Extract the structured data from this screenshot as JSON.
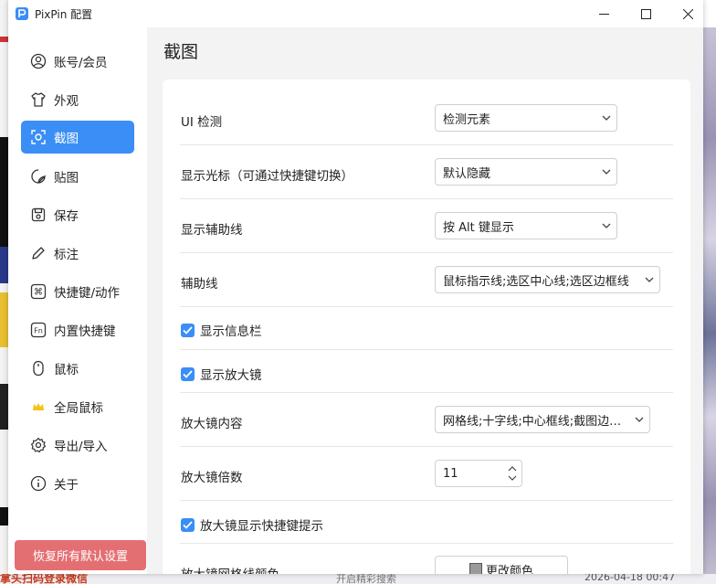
{
  "window": {
    "title": "PixPin 配置",
    "accent": "#3a8ef6"
  },
  "sidebar": {
    "items": [
      {
        "label": "账号/会员",
        "icon": "user-circle-icon"
      },
      {
        "label": "外观",
        "icon": "shirt-icon"
      },
      {
        "label": "截图",
        "icon": "screenshot-icon"
      },
      {
        "label": "贴图",
        "icon": "pin-icon"
      },
      {
        "label": "保存",
        "icon": "save-icon"
      },
      {
        "label": "标注",
        "icon": "pencil-icon"
      },
      {
        "label": "快捷键/动作",
        "icon": "command-key-icon"
      },
      {
        "label": "内置快捷键",
        "icon": "fn-key-icon"
      },
      {
        "label": "鼠标",
        "icon": "mouse-icon"
      },
      {
        "label": "全局鼠标",
        "icon": "crown-icon"
      },
      {
        "label": "导出/导入",
        "icon": "gear-icon"
      },
      {
        "label": "关于",
        "icon": "info-icon"
      }
    ],
    "active_index": 2,
    "reset_label": "恢复所有默认设置",
    "reset_color": "#e46f73"
  },
  "main": {
    "title": "截图",
    "settings": {
      "ui_detect": {
        "label": "UI 检测",
        "value": "检测元素"
      },
      "show_cursor": {
        "label": "显示光标（可通过快捷键切换）",
        "value": "默认隐藏"
      },
      "show_guides": {
        "label": "显示辅助线",
        "value": "按 Alt 键显示"
      },
      "guides": {
        "label": "辅助线",
        "value": "鼠标指示线;选区中心线;选区边框线"
      },
      "show_info_bar": {
        "label": "显示信息栏",
        "checked": true
      },
      "show_magnifier": {
        "label": "显示放大镜",
        "checked": true
      },
      "magnifier_content": {
        "label": "放大镜内容",
        "value": "网格线;十字线;中心框线;截图边框线"
      },
      "magnifier_zoom": {
        "label": "放大镜倍数",
        "value": "11"
      },
      "magnifier_hotkey_tips": {
        "label": "放大镜显示快捷键提示",
        "checked": true
      },
      "magnifier_grid_color": {
        "label": "放大镜网格线颜色",
        "button": "更改颜色",
        "swatch_color": "#9a9a9a"
      }
    }
  },
  "background": {
    "bottom_left_text": "拿头扫码登录微信",
    "bottom_mid_text": "开启精彩搜索",
    "bottom_right_text": "2026-04-18 00:47"
  }
}
